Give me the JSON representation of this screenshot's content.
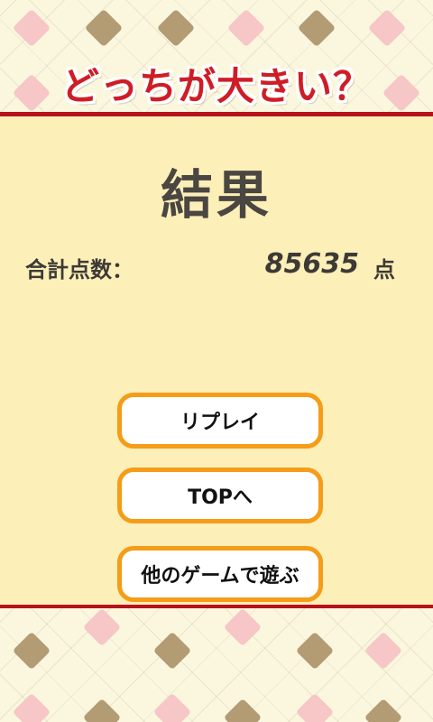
{
  "header": {
    "title": "どっちが大きい？"
  },
  "result": {
    "heading": "結果",
    "score_label": "合計点数：",
    "score_value": "85635",
    "score_unit": "点"
  },
  "buttons": {
    "replay": "リプレイ",
    "top": "TOPへ",
    "more_games": "他のゲームで遊ぶ"
  },
  "colors": {
    "title_red": "#cf1d26",
    "border_red": "#b5121b",
    "button_orange": "#f59c18",
    "panel_yellow": "#fcefb8",
    "diamond_brown": "#b39b74",
    "diamond_pink": "#f7c6c6"
  }
}
